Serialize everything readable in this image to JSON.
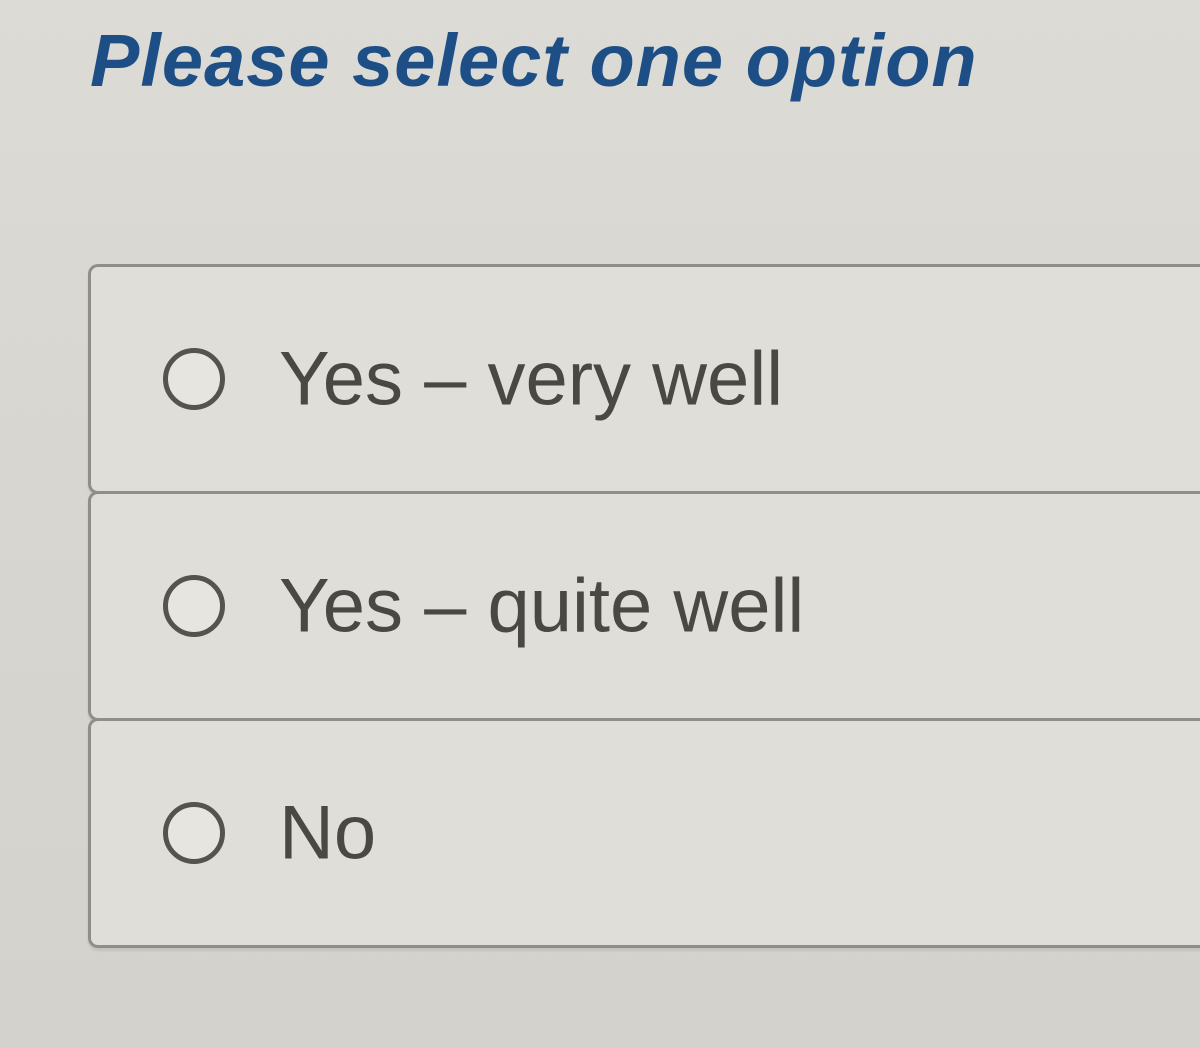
{
  "question": {
    "title": "Please select one option"
  },
  "options": [
    {
      "label": "Yes – very well",
      "selected": false
    },
    {
      "label": "Yes – quite well",
      "selected": false
    },
    {
      "label": "No",
      "selected": false
    }
  ],
  "colors": {
    "title": "#1d4f86",
    "label": "#4a4843",
    "background": "#d8d6d0"
  }
}
